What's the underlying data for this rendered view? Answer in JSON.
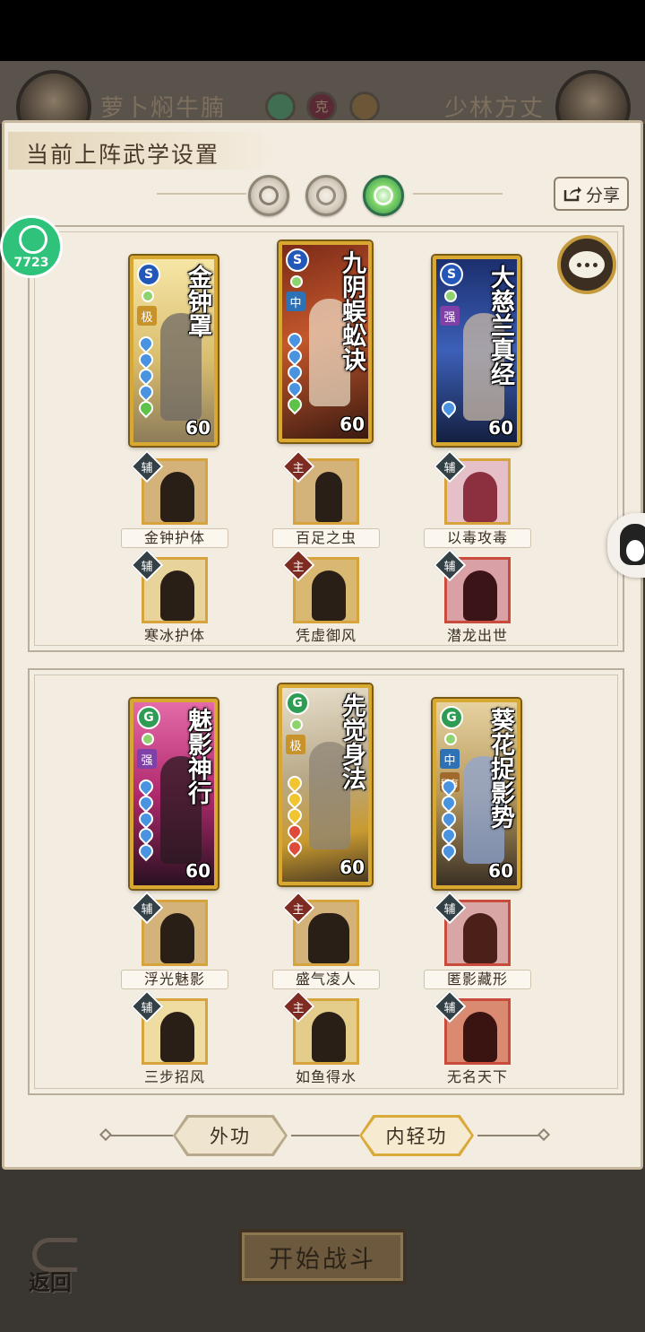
{
  "header": {
    "player_name": "萝卜焖牛腩",
    "opponent_name": "少林方丈",
    "vs_label": "克"
  },
  "panel": {
    "title": "当前上阵武学设置",
    "share_label": "分享",
    "badge_label": "7723",
    "mode_buttons": [
      "moon-mode",
      "sun-mode",
      "green-orb-mode"
    ],
    "active_mode": 2
  },
  "sections": [
    {
      "cards": [
        {
          "name": "金钟罩",
          "tier": "极",
          "type": "S",
          "level": "60",
          "drops": [
            "blue",
            "blue",
            "blue",
            "blue",
            "green"
          ]
        },
        {
          "name": "九阴蜈蚣诀",
          "tier": "中",
          "type": "S",
          "level": "60",
          "drops": [
            "blue",
            "blue",
            "blue",
            "blue",
            "green"
          ]
        },
        {
          "name": "大慈兰真经",
          "tier": "强",
          "type": "S",
          "level": "60",
          "drops": [
            "blue"
          ]
        }
      ],
      "skills_row1": [
        {
          "label": "金钟护体",
          "tag": "辅"
        },
        {
          "label": "百足之虫",
          "tag": "主"
        },
        {
          "label": "以毒攻毒",
          "tag": "辅"
        }
      ],
      "skills_row2": [
        {
          "label": "寒冰护体",
          "tag": "辅"
        },
        {
          "label": "凭虚御风",
          "tag": "主"
        },
        {
          "label": "潜龙出世",
          "tag": "辅"
        }
      ]
    },
    {
      "cards": [
        {
          "name": "魅影神行",
          "tier": "强",
          "type": "G",
          "level": "60",
          "drops": [
            "blue",
            "blue",
            "blue",
            "blue",
            "blue"
          ]
        },
        {
          "name": "先觉身法",
          "tier": "极",
          "type": "G",
          "level": "60",
          "drops": [
            "yellow",
            "yellow",
            "yellow",
            "red",
            "red"
          ]
        },
        {
          "name": "葵花捉影势",
          "tier": "中",
          "tier2": "稀有",
          "type": "G",
          "level": "60",
          "drops": [
            "blue",
            "blue",
            "blue",
            "blue",
            "blue"
          ]
        }
      ],
      "skills_row1": [
        {
          "label": "浮光魅影",
          "tag": "辅"
        },
        {
          "label": "盛气凌人",
          "tag": "主"
        },
        {
          "label": "匿影藏形",
          "tag": "辅"
        }
      ],
      "skills_row2": [
        {
          "label": "三步招风",
          "tag": "辅"
        },
        {
          "label": "如鱼得水",
          "tag": "主"
        },
        {
          "label": "无名天下",
          "tag": "辅"
        }
      ]
    }
  ],
  "tabs": {
    "outer": "外功",
    "inner": "内轻功",
    "active": "inner"
  },
  "bottom": {
    "start_label": "开始战斗",
    "back_label": "返回"
  },
  "colors": {
    "panel_bg": "#f3ece0",
    "card_gold": "#d9a830",
    "active_mode_green": "#2f8a4a"
  }
}
